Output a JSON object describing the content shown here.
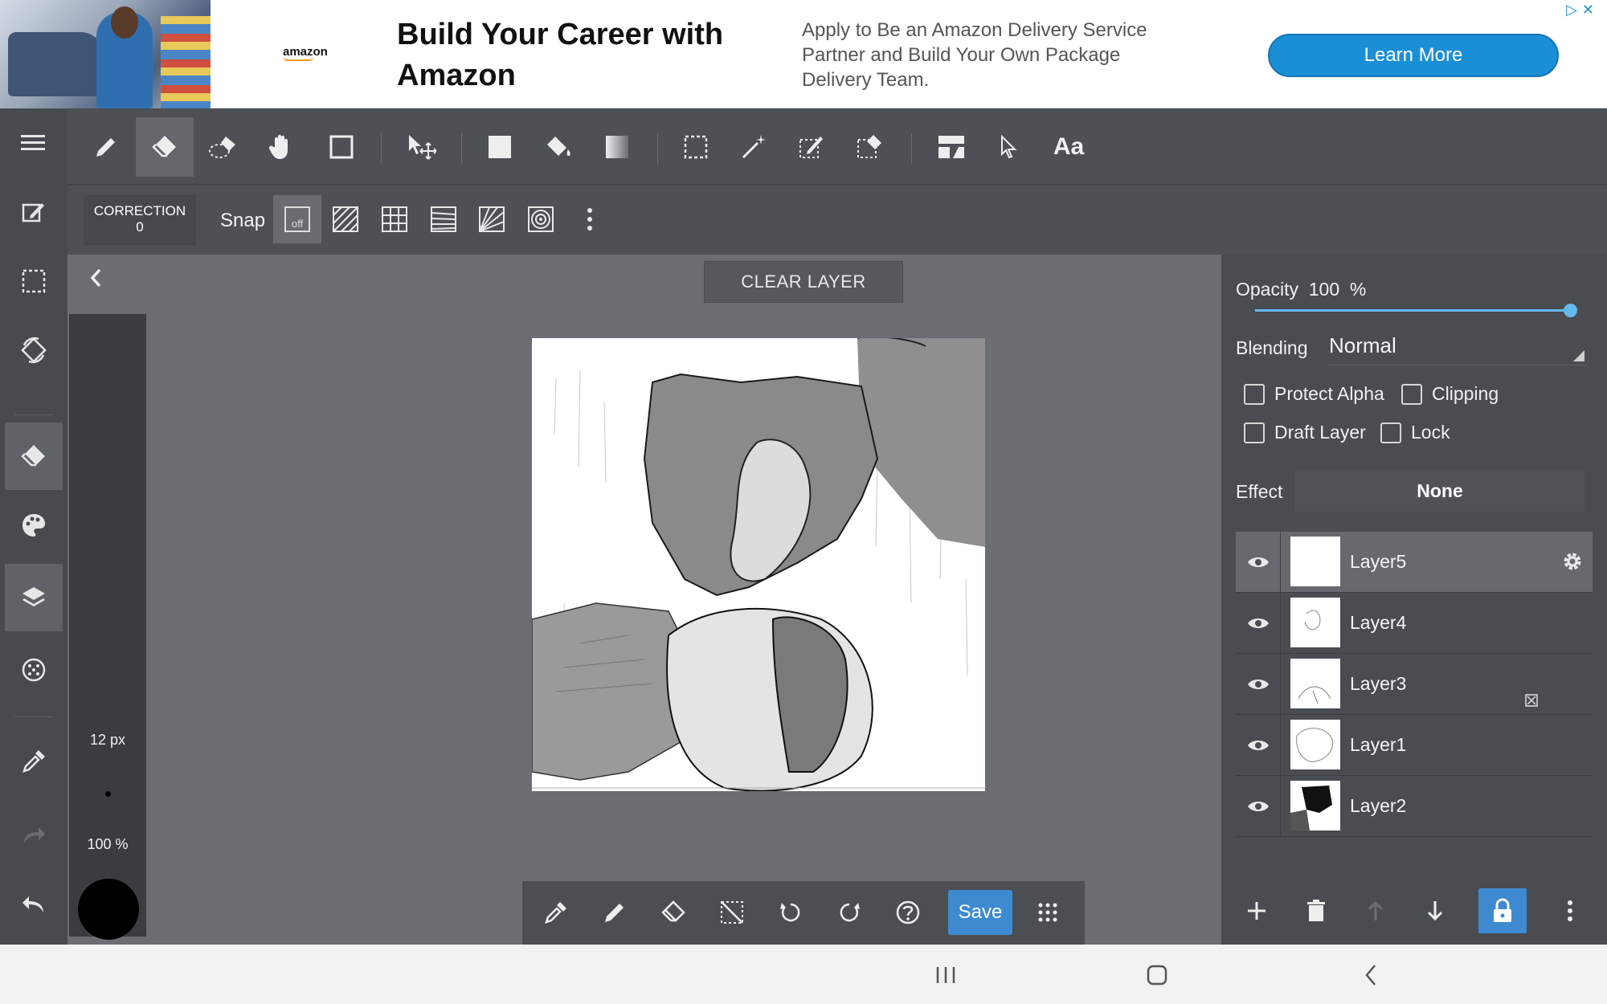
{
  "ad": {
    "brand": "amazon",
    "title": "Build Your Career with Amazon",
    "body": "Apply to Be an Amazon Delivery Service Partner and Build Your Own Package Delivery Team.",
    "cta": "Learn More",
    "close_icons": "▷✕"
  },
  "sidebar": {
    "items": [
      {
        "icon": "menu-icon"
      },
      {
        "icon": "edit-icon"
      },
      {
        "icon": "selection-icon"
      },
      {
        "icon": "rotate-canvas-icon"
      },
      {
        "icon": "eraser-icon",
        "active": true
      },
      {
        "icon": "palette-icon"
      },
      {
        "icon": "layers-icon",
        "active": true
      },
      {
        "icon": "material-icon"
      },
      {
        "icon": "eyedropper-icon"
      },
      {
        "icon": "redo-icon"
      },
      {
        "icon": "undo-icon"
      }
    ]
  },
  "toolbar": {
    "tools": [
      "pen-tool",
      "eraser-tool",
      "blur-tool",
      "hand-tool",
      "shape-tool",
      "move-tool",
      "fill-rect-tool",
      "bucket-tool",
      "gradient-tool",
      "select-tool",
      "magic-wand-tool",
      "select-pen-tool",
      "select-eraser-tool",
      "panel-tool",
      "operation-tool",
      "text-tool"
    ],
    "text_tool_label": "Aa"
  },
  "toolbar2": {
    "correction_label": "CORRECTION",
    "correction_value": "0",
    "snap_label": "Snap",
    "snap_off_label": "off"
  },
  "canvas": {
    "clear_layer_label": "CLEAR LAYER",
    "brush_size": "12 px",
    "brush_opacity": "100 %"
  },
  "bottombar": {
    "save_label": "Save"
  },
  "layer_panel": {
    "opacity_label": "Opacity",
    "opacity_value": "100",
    "opacity_unit": "%",
    "opacity_fraction": 1.0,
    "blending_label": "Blending",
    "blending_value": "Normal",
    "protect_alpha_label": "Protect Alpha",
    "clipping_label": "Clipping",
    "draft_layer_label": "Draft Layer",
    "lock_label": "Lock",
    "effect_label": "Effect",
    "effect_value": "None",
    "layers": [
      {
        "name": "Layer5",
        "selected": true
      },
      {
        "name": "Layer4"
      },
      {
        "name": "Layer3"
      },
      {
        "name": "Layer1"
      },
      {
        "name": "Layer2"
      }
    ]
  },
  "colors": {
    "accent": "#3d8ad1",
    "slider": "#66b9ec",
    "ad_button": "#1a8fd6"
  }
}
